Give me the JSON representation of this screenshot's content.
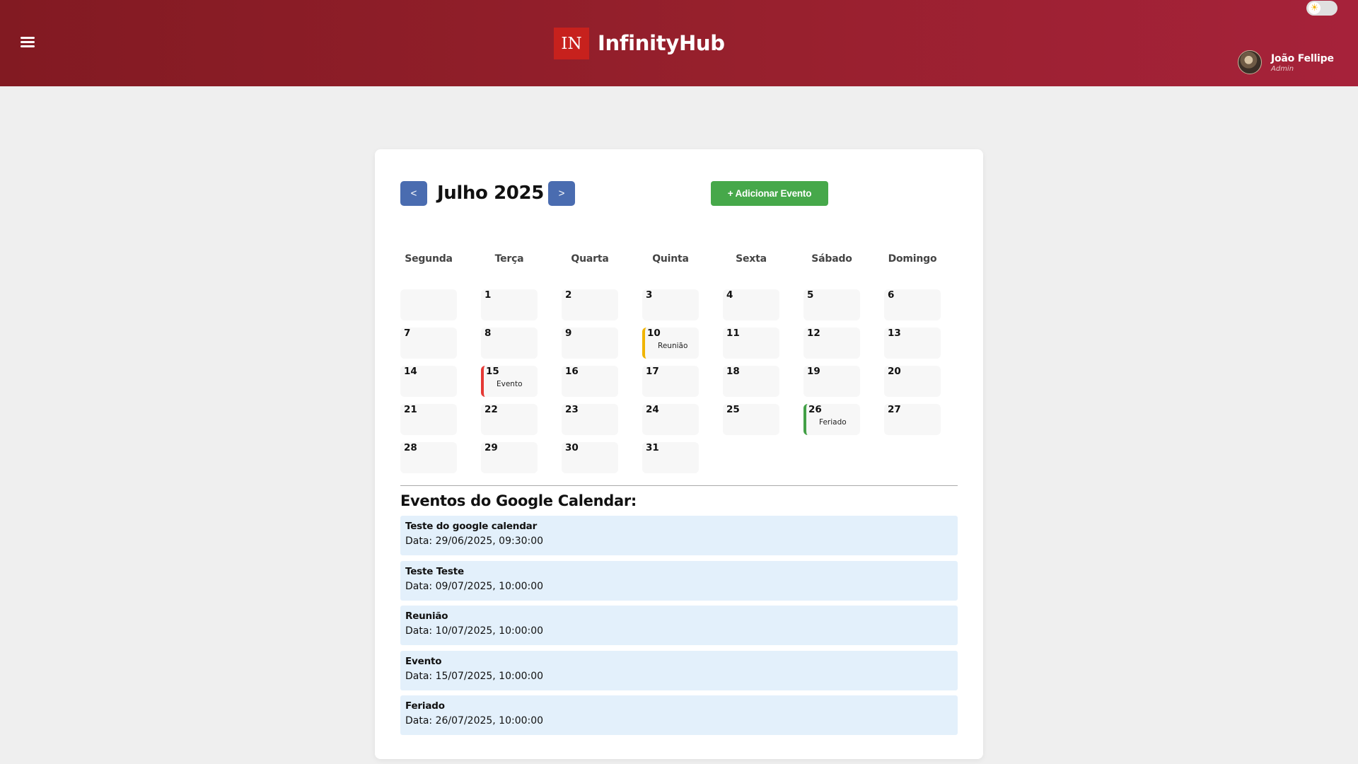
{
  "header": {
    "logo_text": "IN",
    "brand": "InfinityHub",
    "user_name": "João Fellipe",
    "user_role": "Admin",
    "theme_icon": "sun-icon"
  },
  "calendar": {
    "month_label": "Julho 2025",
    "prev_label": "<",
    "next_label": ">",
    "add_event_label": "+ Adicionar Evento",
    "weekdays": [
      "Segunda",
      "Terça",
      "Quarta",
      "Quinta",
      "Sexta",
      "Sábado",
      "Domingo"
    ],
    "first_weekday_offset": 1,
    "days_in_month": 31,
    "day_events": [
      {
        "day": 10,
        "label": "Reunião",
        "color": "#f0b400"
      },
      {
        "day": 15,
        "label": "Evento",
        "color": "#e53935"
      },
      {
        "day": 26,
        "label": "Feriado",
        "color": "#43a047"
      }
    ]
  },
  "google_events": {
    "title": "Eventos do Google Calendar:",
    "items": [
      {
        "title": "Teste do google calendar",
        "date": "Data: 29/06/2025, 09:30:00"
      },
      {
        "title": "Teste Teste",
        "date": "Data: 09/07/2025, 10:00:00"
      },
      {
        "title": "Reunião",
        "date": "Data: 10/07/2025, 10:00:00"
      },
      {
        "title": "Evento",
        "date": "Data: 15/07/2025, 10:00:00"
      },
      {
        "title": "Feriado",
        "date": "Data: 26/07/2025, 10:00:00"
      }
    ]
  },
  "colors": {
    "header_gradient_start": "#821a22",
    "header_gradient_end": "#a6223a",
    "nav_button": "#4a6cb0",
    "add_button": "#46a84a",
    "event_item_bg": "#e3f0fb"
  }
}
